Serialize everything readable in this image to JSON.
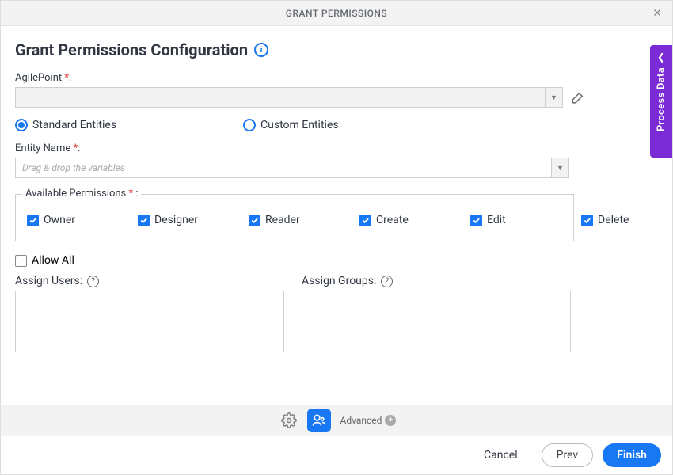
{
  "titlebar": {
    "title": "GRANT PERMISSIONS"
  },
  "sidetab": {
    "label": "Process Data"
  },
  "header": {
    "title": "Grant Permissions Configuration"
  },
  "fields": {
    "agilepoint_label": "AgilePoint ",
    "entity_type": {
      "standard": "Standard Entities",
      "custom": "Custom Entities"
    },
    "entity_name_label": "Entity Name ",
    "entity_name_placeholder": "Drag & drop the variables",
    "permissions_legend": "Available Permissions  ",
    "permissions": {
      "owner": "Owner",
      "designer": "Designer",
      "reader": "Reader",
      "create": "Create",
      "edit": "Edit",
      "delete": "Delete"
    },
    "allow_all": "Allow All",
    "assign_users": "Assign Users:",
    "assign_groups": "Assign Groups:"
  },
  "toolbar": {
    "advanced": "Advanced"
  },
  "footer": {
    "cancel": "Cancel",
    "prev": "Prev",
    "finish": "Finish"
  }
}
